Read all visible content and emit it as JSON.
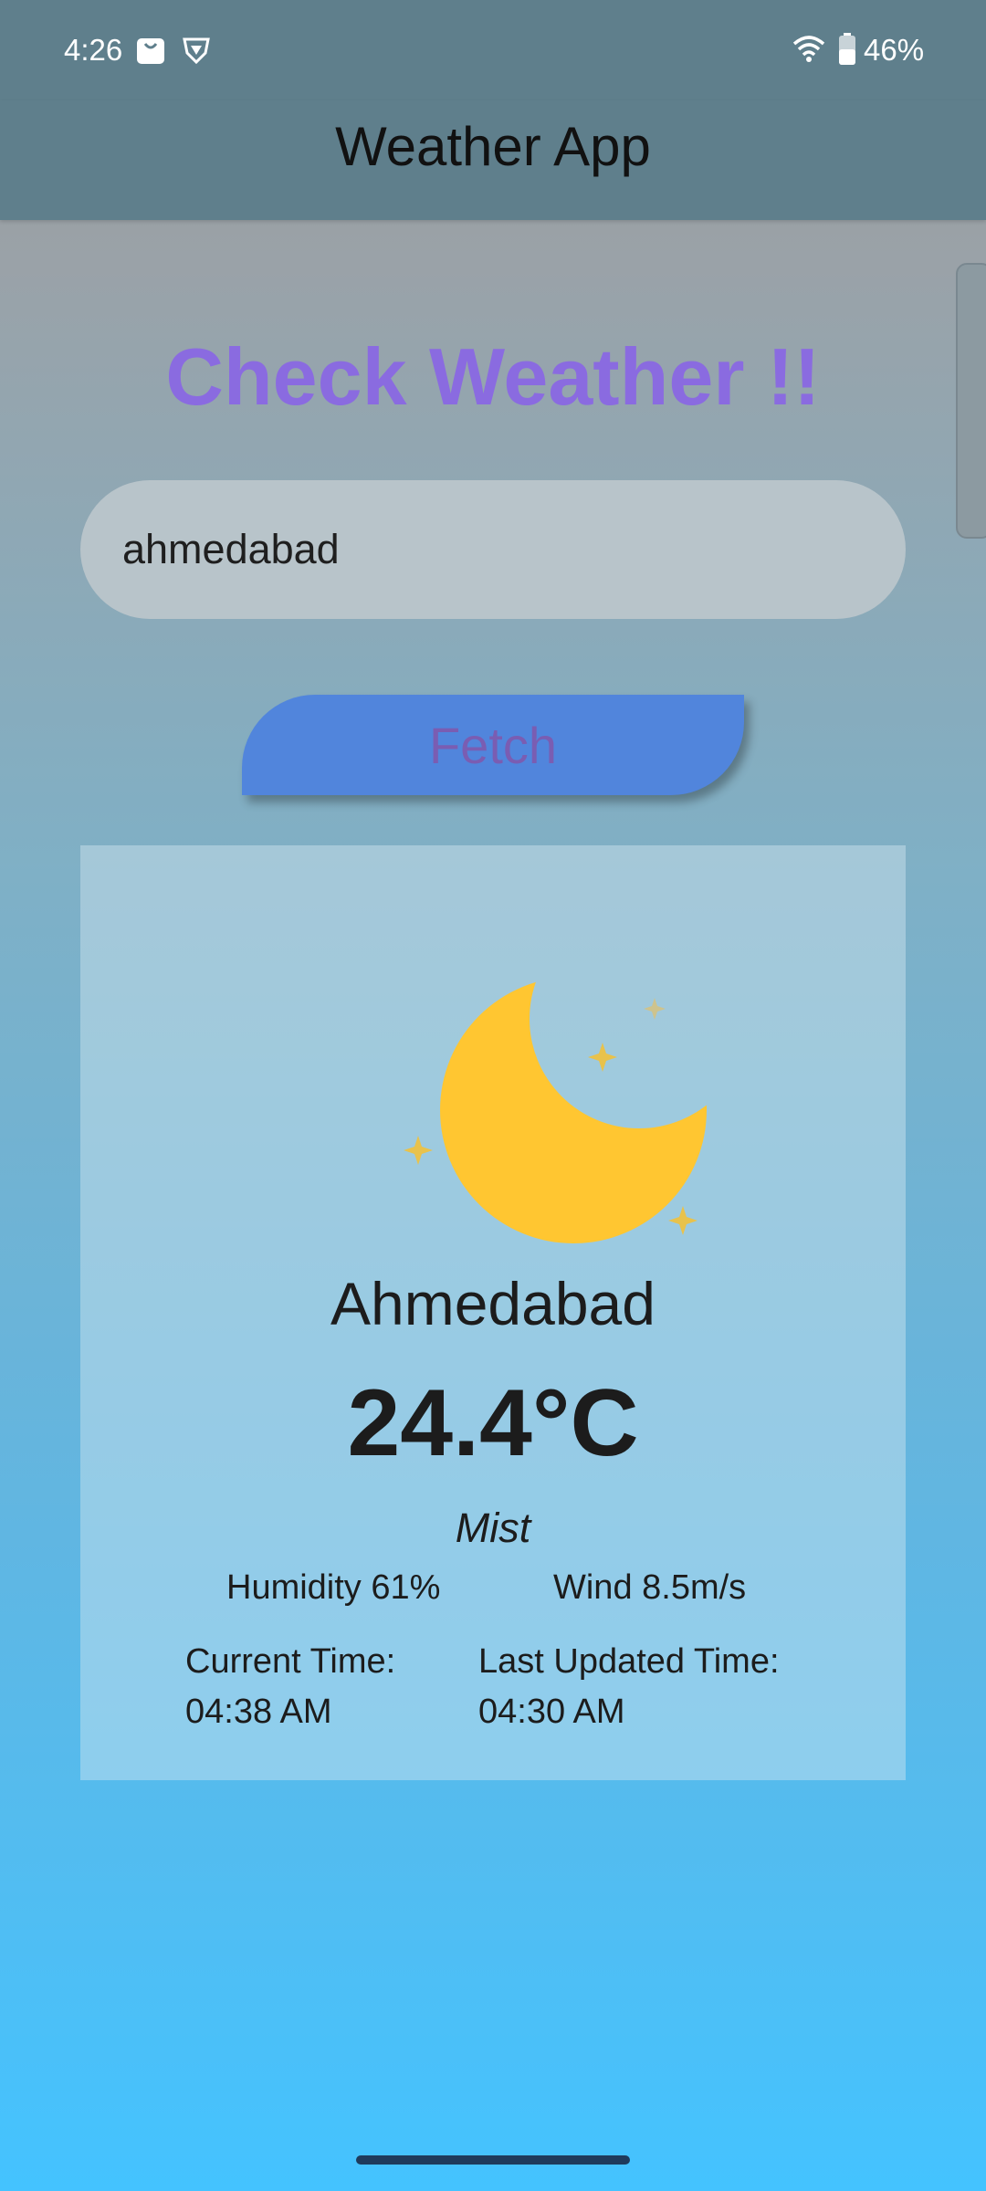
{
  "status_bar": {
    "time": "4:26",
    "battery": "46%"
  },
  "app_bar": {
    "title": "Weather App"
  },
  "heading": "Check Weather !!",
  "search": {
    "value": "ahmedabad"
  },
  "fetch_button": {
    "label": "Fetch"
  },
  "weather": {
    "icon": "moon-stars-icon",
    "city": "Ahmedabad",
    "temperature": "24.4°C",
    "condition": "Mist",
    "humidity": "Humidity 61%",
    "wind": "Wind 8.5m/s",
    "current_time_label": "Current Time:",
    "current_time": "04:38 AM",
    "last_updated_label": "Last Updated Time:",
    "last_updated": "04:30 AM"
  },
  "colors": {
    "app_bar": "#5f7f8c",
    "heading": "#8a6be0",
    "button": "#5185dc",
    "button_text": "#7a5db2",
    "moon": "#ffc631"
  }
}
